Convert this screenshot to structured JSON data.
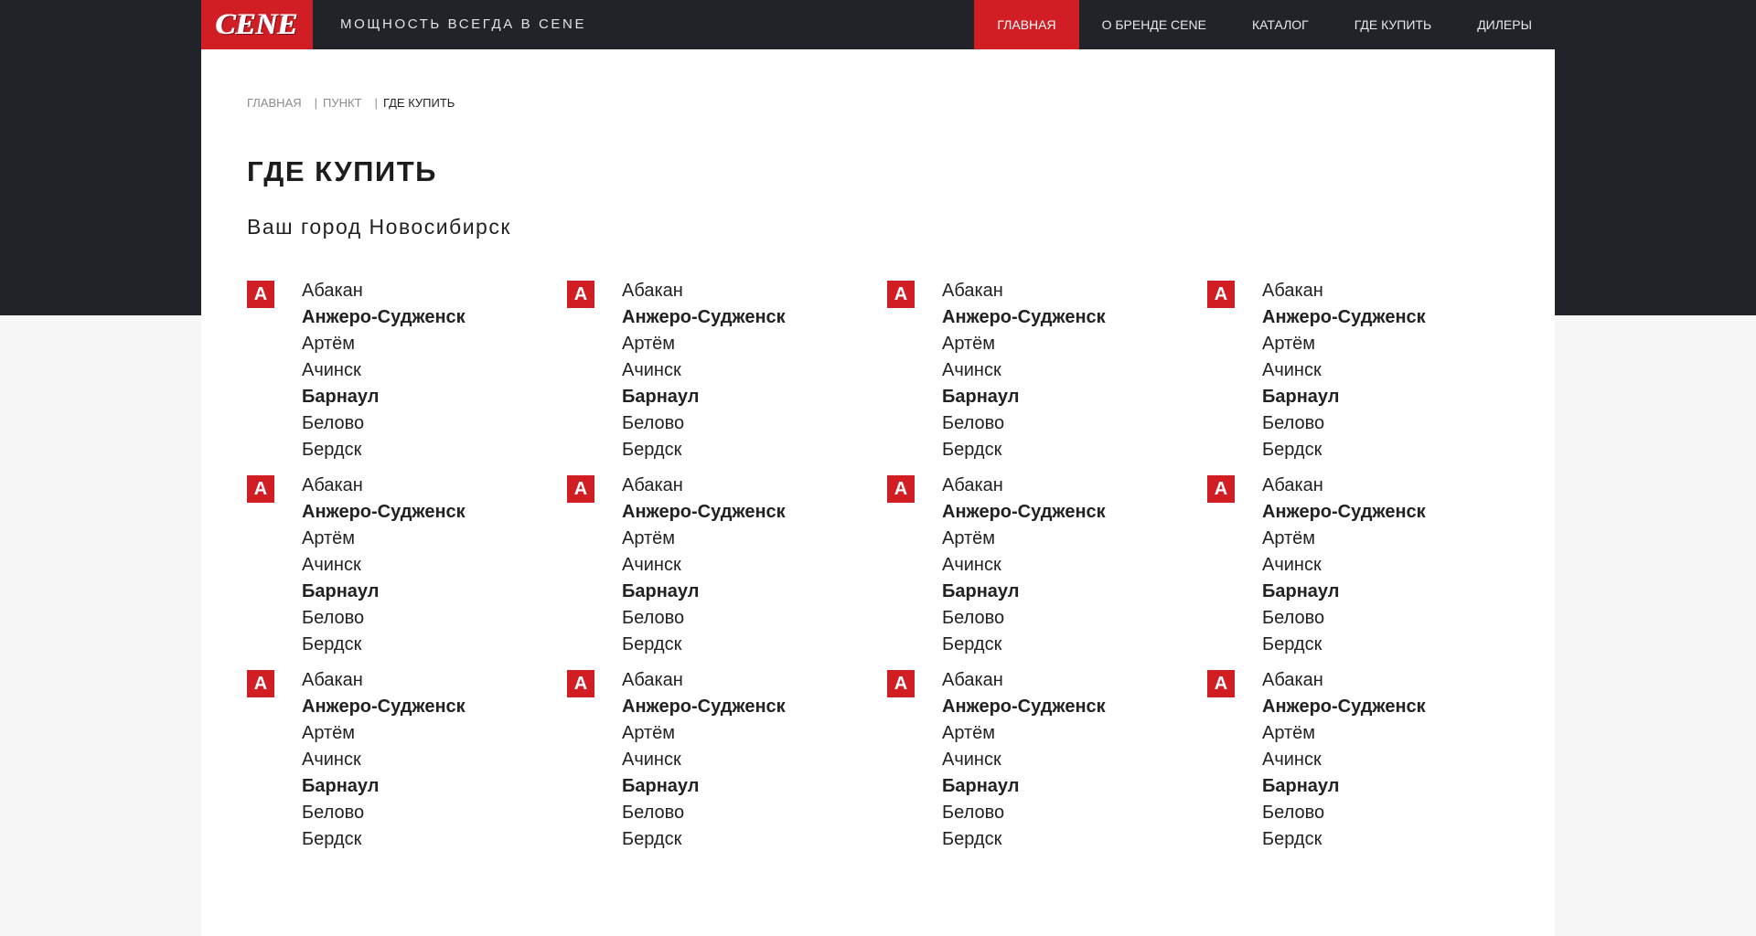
{
  "brand": {
    "logo_text": "CENE",
    "tagline": "МОЩНОСТЬ ВСЕГДА В CENE"
  },
  "nav": {
    "items": [
      {
        "label": "ГЛАВНАЯ",
        "active": true
      },
      {
        "label": "О БРЕНДЕ CENE",
        "active": false
      },
      {
        "label": "КАТАЛОГ",
        "active": false
      },
      {
        "label": "ГДЕ КУПИТЬ",
        "active": false
      },
      {
        "label": "ДИЛЕРЫ",
        "active": false
      }
    ]
  },
  "breadcrumb": {
    "items": [
      "ГЛАВНАЯ",
      "ПУНКТ",
      "ГДЕ КУПИТЬ"
    ],
    "separator": "|"
  },
  "page": {
    "title": "ГДЕ КУПИТЬ",
    "city_label": "Ваш город Новосибирск"
  },
  "colors": {
    "accent": "#d11d24",
    "header_bg": "#202328",
    "text": "#222222"
  },
  "city_groups": [
    {
      "letter": "А",
      "cities": [
        {
          "name": "Абакан",
          "bold": false
        },
        {
          "name": "Анжеро-Судженск",
          "bold": true
        },
        {
          "name": "Артём",
          "bold": false
        },
        {
          "name": "Ачинск",
          "bold": false
        },
        {
          "name": "Барнаул",
          "bold": true
        },
        {
          "name": "Белово",
          "bold": false
        },
        {
          "name": "Бердск",
          "bold": false
        }
      ]
    },
    {
      "letter": "А",
      "cities": [
        {
          "name": "Абакан",
          "bold": false
        },
        {
          "name": "Анжеро-Судженск",
          "bold": true
        },
        {
          "name": "Артём",
          "bold": false
        },
        {
          "name": "Ачинск",
          "bold": false
        },
        {
          "name": "Барнаул",
          "bold": true
        },
        {
          "name": "Белово",
          "bold": false
        },
        {
          "name": "Бердск",
          "bold": false
        }
      ]
    },
    {
      "letter": "А",
      "cities": [
        {
          "name": "Абакан",
          "bold": false
        },
        {
          "name": "Анжеро-Судженск",
          "bold": true
        },
        {
          "name": "Артём",
          "bold": false
        },
        {
          "name": "Ачинск",
          "bold": false
        },
        {
          "name": "Барнаул",
          "bold": true
        },
        {
          "name": "Белово",
          "bold": false
        },
        {
          "name": "Бердск",
          "bold": false
        }
      ]
    },
    {
      "letter": "А",
      "cities": [
        {
          "name": "Абакан",
          "bold": false
        },
        {
          "name": "Анжеро-Судженск",
          "bold": true
        },
        {
          "name": "Артём",
          "bold": false
        },
        {
          "name": "Ачинск",
          "bold": false
        },
        {
          "name": "Барнаул",
          "bold": true
        },
        {
          "name": "Белово",
          "bold": false
        },
        {
          "name": "Бердск",
          "bold": false
        }
      ]
    },
    {
      "letter": "А",
      "cities": [
        {
          "name": "Абакан",
          "bold": false
        },
        {
          "name": "Анжеро-Судженск",
          "bold": true
        },
        {
          "name": "Артём",
          "bold": false
        },
        {
          "name": "Ачинск",
          "bold": false
        },
        {
          "name": "Барнаул",
          "bold": true
        },
        {
          "name": "Белово",
          "bold": false
        },
        {
          "name": "Бердск",
          "bold": false
        }
      ]
    },
    {
      "letter": "А",
      "cities": [
        {
          "name": "Абакан",
          "bold": false
        },
        {
          "name": "Анжеро-Судженск",
          "bold": true
        },
        {
          "name": "Артём",
          "bold": false
        },
        {
          "name": "Ачинск",
          "bold": false
        },
        {
          "name": "Барнаул",
          "bold": true
        },
        {
          "name": "Белово",
          "bold": false
        },
        {
          "name": "Бердск",
          "bold": false
        }
      ]
    },
    {
      "letter": "А",
      "cities": [
        {
          "name": "Абакан",
          "bold": false
        },
        {
          "name": "Анжеро-Судженск",
          "bold": true
        },
        {
          "name": "Артём",
          "bold": false
        },
        {
          "name": "Ачинск",
          "bold": false
        },
        {
          "name": "Барнаул",
          "bold": true
        },
        {
          "name": "Белово",
          "bold": false
        },
        {
          "name": "Бердск",
          "bold": false
        }
      ]
    },
    {
      "letter": "А",
      "cities": [
        {
          "name": "Абакан",
          "bold": false
        },
        {
          "name": "Анжеро-Судженск",
          "bold": true
        },
        {
          "name": "Артём",
          "bold": false
        },
        {
          "name": "Ачинск",
          "bold": false
        },
        {
          "name": "Барнаул",
          "bold": true
        },
        {
          "name": "Белово",
          "bold": false
        },
        {
          "name": "Бердск",
          "bold": false
        }
      ]
    },
    {
      "letter": "А",
      "cities": [
        {
          "name": "Абакан",
          "bold": false
        },
        {
          "name": "Анжеро-Судженск",
          "bold": true
        },
        {
          "name": "Артём",
          "bold": false
        },
        {
          "name": "Ачинск",
          "bold": false
        },
        {
          "name": "Барнаул",
          "bold": true
        },
        {
          "name": "Белово",
          "bold": false
        },
        {
          "name": "Бердск",
          "bold": false
        }
      ]
    },
    {
      "letter": "А",
      "cities": [
        {
          "name": "Абакан",
          "bold": false
        },
        {
          "name": "Анжеро-Судженск",
          "bold": true
        },
        {
          "name": "Артём",
          "bold": false
        },
        {
          "name": "Ачинск",
          "bold": false
        },
        {
          "name": "Барнаул",
          "bold": true
        },
        {
          "name": "Белово",
          "bold": false
        },
        {
          "name": "Бердск",
          "bold": false
        }
      ]
    },
    {
      "letter": "А",
      "cities": [
        {
          "name": "Абакан",
          "bold": false
        },
        {
          "name": "Анжеро-Судженск",
          "bold": true
        },
        {
          "name": "Артём",
          "bold": false
        },
        {
          "name": "Ачинск",
          "bold": false
        },
        {
          "name": "Барнаул",
          "bold": true
        },
        {
          "name": "Белово",
          "bold": false
        },
        {
          "name": "Бердск",
          "bold": false
        }
      ]
    },
    {
      "letter": "А",
      "cities": [
        {
          "name": "Абакан",
          "bold": false
        },
        {
          "name": "Анжеро-Судженск",
          "bold": true
        },
        {
          "name": "Артём",
          "bold": false
        },
        {
          "name": "Ачинск",
          "bold": false
        },
        {
          "name": "Барнаул",
          "bold": true
        },
        {
          "name": "Белово",
          "bold": false
        },
        {
          "name": "Бердск",
          "bold": false
        }
      ]
    }
  ]
}
